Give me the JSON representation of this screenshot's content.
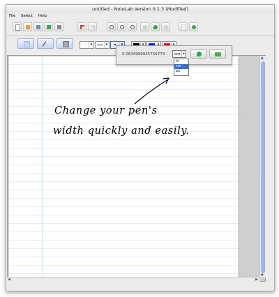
{
  "window": {
    "title": "untitled  -  NoteLab Version 0.1.3  (Modified)"
  },
  "menu": {
    "file": "File",
    "select": "Select",
    "help": "Help"
  },
  "pen_popup": {
    "width_value": "0.0634999945759773",
    "unit_selected": "cm",
    "unit_options": [
      "in",
      "cm",
      "px"
    ]
  },
  "handwriting": {
    "line1": "Change   your pen's",
    "line2": "width quickly and easily."
  },
  "colors": {
    "pen_black": "#000000",
    "pen_blue": "#1e2bd6",
    "pen_red": "#e21616",
    "accent": "#3d6fd0"
  },
  "icons": [
    "new-page-icon",
    "open-icon",
    "save-icon",
    "export-icon",
    "print-icon",
    "undo-icon",
    "redo-icon",
    "zoom-out-icon",
    "zoom-in-icon",
    "zoom-fit-icon",
    "previous-page-icon",
    "pen-icon",
    "next-page-icon",
    "page-icon",
    "refresh-icon",
    "select-tool-icon",
    "pen-tool-icon",
    "eraser-tool-icon",
    "accept-icon",
    "load-icon"
  ]
}
